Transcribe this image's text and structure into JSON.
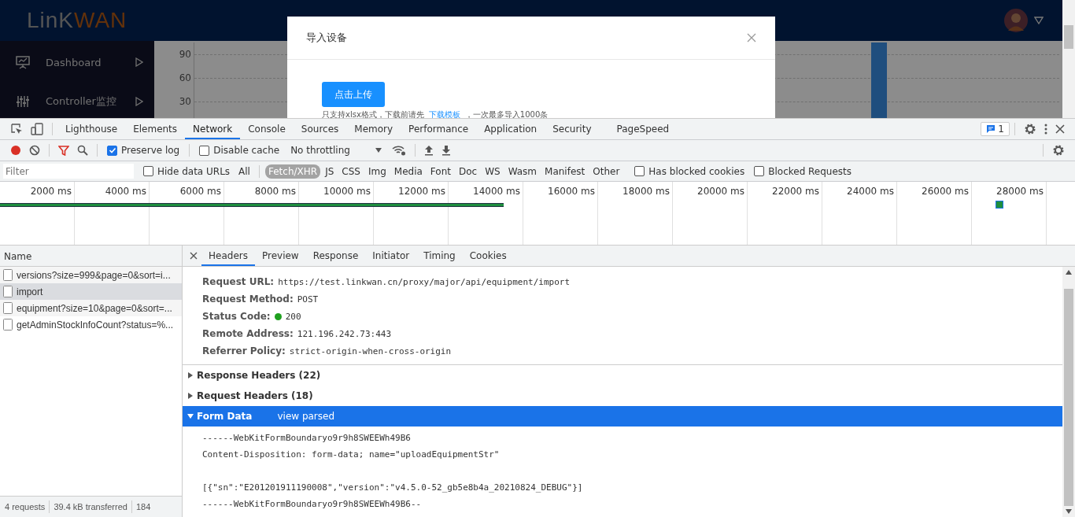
{
  "app": {
    "logo_left": "LinK",
    "logo_right": "WAN",
    "sidebar": [
      {
        "label": "Dashboard"
      },
      {
        "label": "Controller监控"
      }
    ],
    "chart_ticks": [
      "90",
      "60",
      "30"
    ]
  },
  "modal": {
    "title": "导入设备",
    "upload_button": "点击上传",
    "hint_before": "只支持xlsx格式，下载前请先",
    "hint_link": "下载模板",
    "hint_after": "，一次最多导入1000条"
  },
  "devtools": {
    "tabs": [
      {
        "label": "Lighthouse",
        "selected": false
      },
      {
        "label": "Elements",
        "selected": false
      },
      {
        "label": "Network",
        "selected": true
      },
      {
        "label": "Console",
        "selected": false
      },
      {
        "label": "Sources",
        "selected": false
      },
      {
        "label": "Memory",
        "selected": false
      },
      {
        "label": "Performance",
        "selected": false
      },
      {
        "label": "Application",
        "selected": false
      },
      {
        "label": "Security",
        "selected": false
      },
      {
        "label": "PageSpeed",
        "selected": false
      }
    ],
    "issues_badge": "1",
    "toolbar": {
      "recording": true,
      "preserve_log": {
        "label": "Preserve log",
        "checked": true
      },
      "disable_cache": {
        "label": "Disable cache",
        "checked": false
      },
      "throttling": "No throttling"
    },
    "filter": {
      "placeholder": "Filter",
      "hide_data_urls": {
        "label": "Hide data URLs",
        "checked": false
      },
      "types": [
        {
          "label": "All",
          "selected": false
        },
        {
          "label": "Fetch/XHR",
          "selected": true
        },
        {
          "label": "JS",
          "selected": false
        },
        {
          "label": "CSS",
          "selected": false
        },
        {
          "label": "Img",
          "selected": false
        },
        {
          "label": "Media",
          "selected": false
        },
        {
          "label": "Font",
          "selected": false
        },
        {
          "label": "Doc",
          "selected": false
        },
        {
          "label": "WS",
          "selected": false
        },
        {
          "label": "Wasm",
          "selected": false
        },
        {
          "label": "Manifest",
          "selected": false
        },
        {
          "label": "Other",
          "selected": false
        }
      ],
      "has_blocked_cookies": {
        "label": "Has blocked cookies",
        "checked": false
      },
      "blocked_requests": {
        "label": "Blocked Requests",
        "checked": false
      }
    },
    "timeline_ticks": [
      "2000 ms",
      "4000 ms",
      "6000 ms",
      "8000 ms",
      "10000 ms",
      "12000 ms",
      "14000 ms",
      "16000 ms",
      "18000 ms",
      "20000 ms",
      "22000 ms",
      "24000 ms",
      "26000 ms",
      "28000 ms"
    ],
    "requests": {
      "column": "Name",
      "rows": [
        {
          "name": "versions?size=999&page=0&sort=i...",
          "selected": false
        },
        {
          "name": "import",
          "selected": true
        },
        {
          "name": "equipment?size=10&page=0&sort=...",
          "selected": false
        },
        {
          "name": "getAdminStockInfoCount?status=%...",
          "selected": false
        }
      ]
    },
    "status_bar": [
      "4 requests",
      "39.4 kB transferred",
      "184"
    ],
    "detail_tabs": [
      {
        "label": "Headers",
        "selected": true
      },
      {
        "label": "Preview",
        "selected": false
      },
      {
        "label": "Response",
        "selected": false
      },
      {
        "label": "Initiator",
        "selected": false
      },
      {
        "label": "Timing",
        "selected": false
      },
      {
        "label": "Cookies",
        "selected": false
      }
    ],
    "general": [
      {
        "key": "Request URL:",
        "value": "https://test.linkwan.cn/proxy/major/api/equipment/import"
      },
      {
        "key": "Request Method:",
        "value": "POST"
      },
      {
        "key": "Status Code:",
        "value": "200",
        "color": "#1fa01f"
      },
      {
        "key": "Remote Address:",
        "value": "121.196.242.73:443"
      },
      {
        "key": "Referrer Policy:",
        "value": "strict-origin-when-cross-origin"
      }
    ],
    "sections": [
      {
        "title": "Response Headers (22)",
        "expanded": false,
        "selected": false
      },
      {
        "title": "Request Headers (18)",
        "expanded": false,
        "selected": false
      },
      {
        "title": "Form Data",
        "expanded": true,
        "selected": true,
        "action": "view parsed"
      }
    ],
    "form_lines": [
      {
        "text": "------WebKitFormBoundaryo9r9h8SWEEWh49B6",
        "blank_before": false
      },
      {
        "text": "Content-Disposition: form-data; name=\"uploadEquipmentStr\"",
        "blank_before": false
      },
      {
        "text": "[{\"sn\":\"E201201911190008\",\"version\":\"v4.5.0-52_gb5e8b4a_20210824_DEBUG\"}]",
        "blank_before": true
      },
      {
        "text": "------WebKitFormBoundaryo9r9h8SWEEWh49B6--",
        "blank_before": false
      }
    ]
  }
}
